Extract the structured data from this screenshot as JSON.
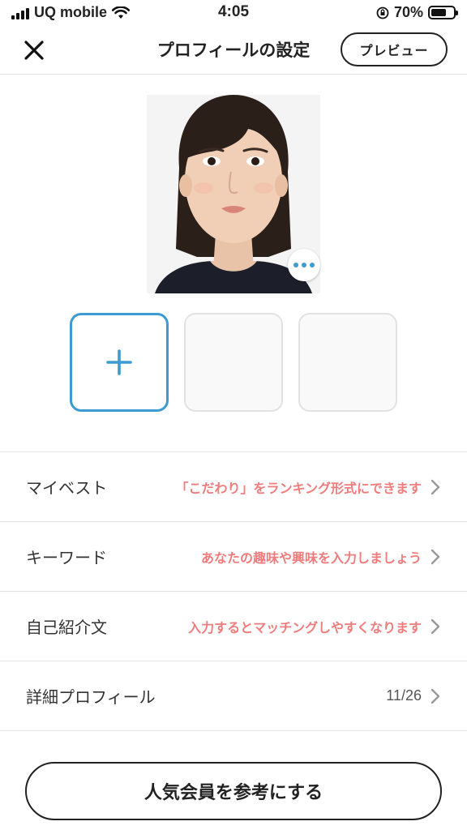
{
  "status_bar": {
    "carrier": "UQ mobile",
    "time": "4:05",
    "battery_percent": "70%",
    "battery_level": 0.7
  },
  "header": {
    "title": "プロフィールの設定",
    "close_icon": "close-icon",
    "preview_label": "プレビュー"
  },
  "photos": {
    "main_photo_icon": "profile-photo",
    "more_icon": "more-dots-icon",
    "add_icon": "plus-icon",
    "slot_count": 3
  },
  "rows": [
    {
      "label": "マイベスト",
      "hint": "「こだわり」をランキング形式にできます"
    },
    {
      "label": "キーワード",
      "hint": "あなたの趣味や興味を入力しましょう"
    },
    {
      "label": "自己紹介文",
      "hint": "入力するとマッチングしやすくなります"
    },
    {
      "label": "詳細プロフィール",
      "count": "11/26"
    }
  ],
  "cta_label": "人気会員を参考にする",
  "colors": {
    "accent": "#3b9bd2",
    "hint_text": "#f07c7c",
    "divider": "#e3e3e3"
  }
}
